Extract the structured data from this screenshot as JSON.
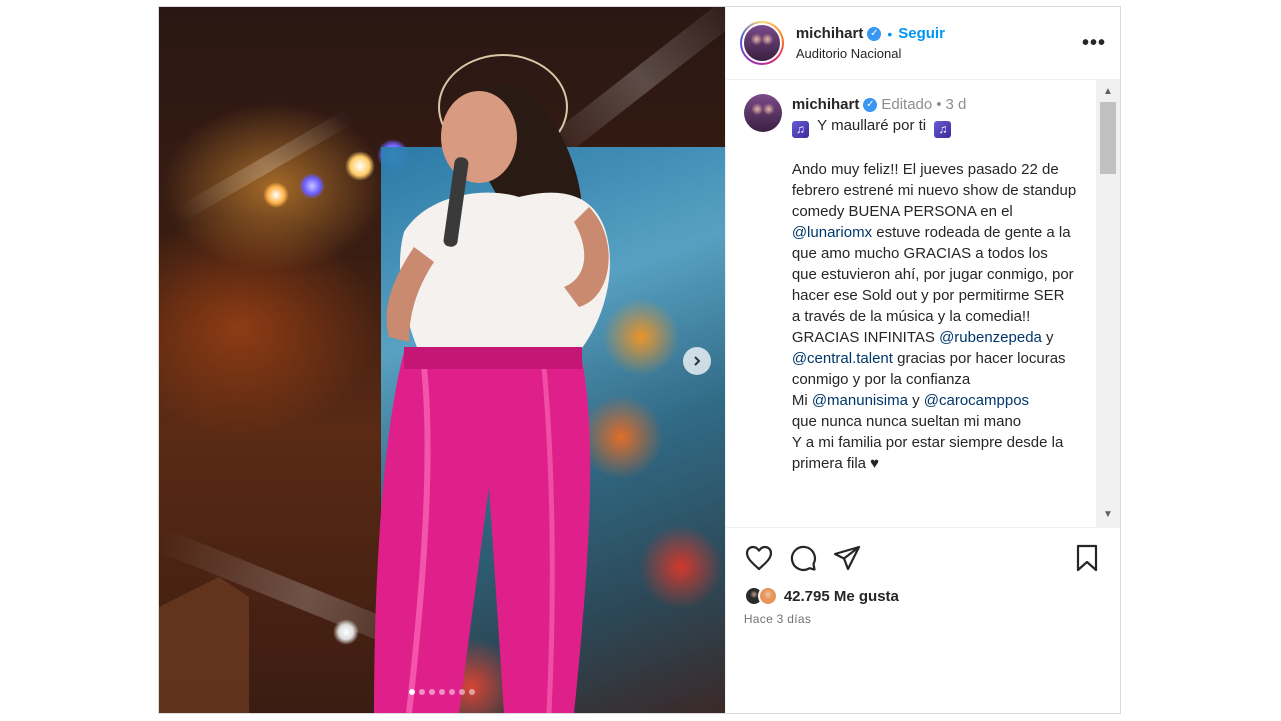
{
  "post": {
    "username": "michihart",
    "follow_label": "Seguir",
    "separator": "•",
    "location": "Auditorio Nacional",
    "more_label": "•••",
    "carousel": {
      "slide_count": 7,
      "active_index": 0
    }
  },
  "caption": {
    "username": "michihart",
    "edited_label": "Editado",
    "dot": "•",
    "age": "3 d",
    "line1": "Y maullaré por ti",
    "p1_a": "Ando muy feliz!! El jueves pasado 22 de febrero estrené mi nuevo show de standup comedy BUENA PERSONA en el ",
    "p1_mention": "@lunariomx",
    "p1_b": " estuve rodeada de gente a la que amo mucho GRACIAS a todos los que estuvieron ahí, por jugar conmigo, por hacer ese Sold out y por permitirme SER a través de la música y la comedia!!",
    "p2_a": "GRACIAS INFINITAS ",
    "p2_mention1": "@rubenzepeda",
    "p2_b": " y ",
    "p2_mention2": "@central.talent",
    "p2_c": " gracias por hacer locuras conmigo y por la confianza",
    "p3_a": "Mi ",
    "p3_mention1": "@manunisima",
    "p3_b": " y ",
    "p3_mention2": "@carocamppos",
    "p3_c": "que nunca nunca sueltan mi mano",
    "p4": "Y a mi familia por estar siempre desde la primera fila ♥"
  },
  "stats": {
    "likes": "42.795 Me gusta",
    "time": "Hace 3 días"
  },
  "icons": {
    "like": "heart-icon",
    "comment": "comment-icon",
    "share": "share-icon",
    "save": "bookmark-icon",
    "next": "chevron-right-icon"
  },
  "colors": {
    "link": "#0095f6",
    "mention": "#00376b",
    "verified": "#3897f0"
  }
}
